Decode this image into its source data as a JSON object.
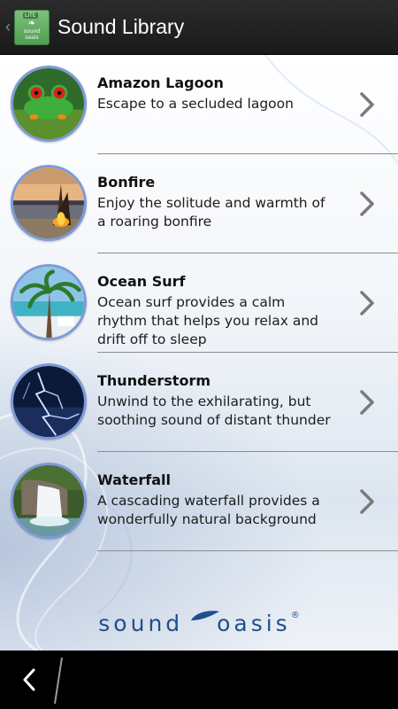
{
  "actionbar": {
    "title": "Sound Library",
    "icon_badge": "LITE",
    "icon_text_1": "sound",
    "icon_text_2": "oasis"
  },
  "sounds": [
    {
      "title": "Amazon Lagoon",
      "description": "Escape to a secluded lagoon"
    },
    {
      "title": "Bonfire",
      "description": "Enjoy the solitude and warmth of a roaring bonfire"
    },
    {
      "title": "Ocean Surf",
      "description": "Ocean surf provides a calm rhythm that helps you relax and drift off to sleep"
    },
    {
      "title": "Thunderstorm",
      "description": "Unwind to the exhilarating, but soothing sound of distant thunder"
    },
    {
      "title": "Waterfall",
      "description": "A cascading waterfall provides a wonderfully natural background"
    }
  ],
  "brand": {
    "word1": "sound",
    "word2": "oasis",
    "reg": "®"
  },
  "colors": {
    "accent_ring": "#7d9ad6",
    "brand": "#1f4f8c",
    "actionbar": "#222222"
  },
  "icons": {
    "chevron": "chevron-right-icon",
    "nav_back": "back-arrow-icon"
  }
}
